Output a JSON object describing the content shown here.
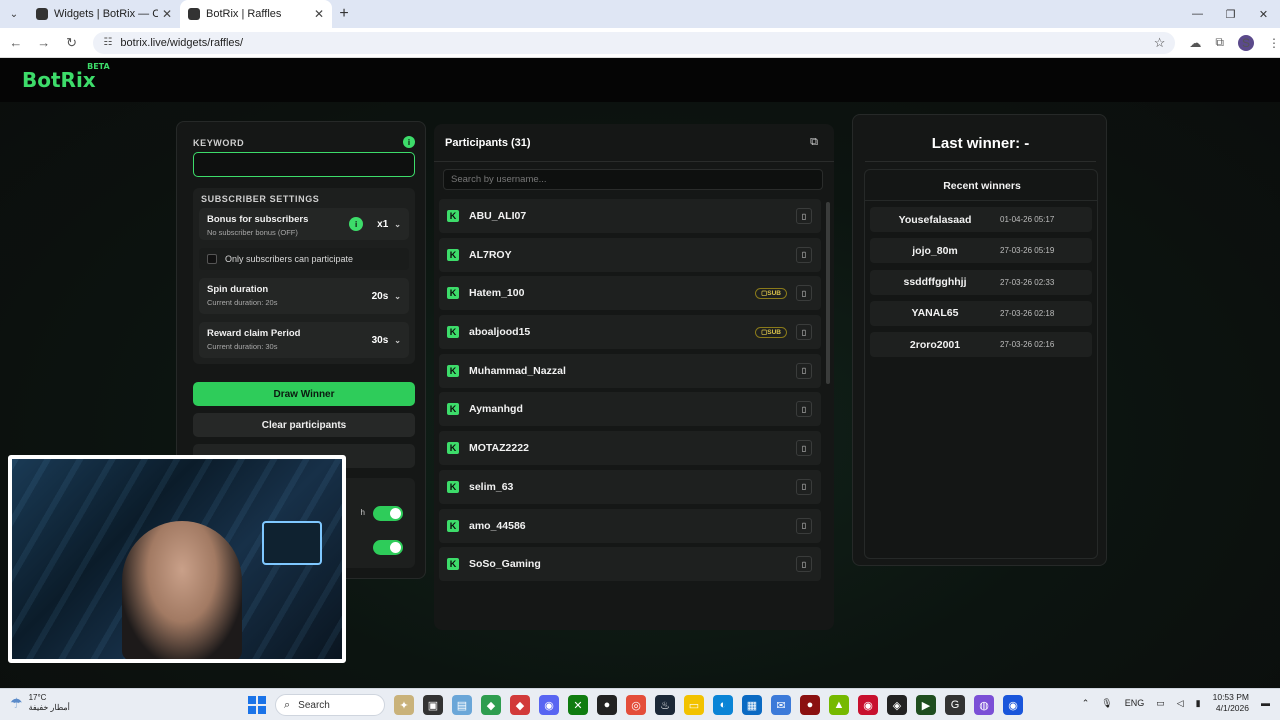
{
  "browser": {
    "tabs": [
      {
        "title": "Widgets | BotRix — Cloud Strea",
        "active": false
      },
      {
        "title": "BotRix | Raffles",
        "active": true
      }
    ],
    "url": "botrix.live/widgets/raffles/",
    "profile_initial": "S"
  },
  "app": {
    "logo": "BotRix",
    "logo_badge": "BETA",
    "accent_color": "#3ddc6a"
  },
  "settings": {
    "keyword_label": "KEYWORD",
    "keyword_value": "",
    "subscriber_settings_label": "SUBSCRIBER SETTINGS",
    "bonus": {
      "name": "Bonus for subscribers",
      "sub": "No subscriber bonus (OFF)",
      "value": "x1"
    },
    "only_subs_label": "Only subscribers can participate",
    "only_subs_checked": false,
    "spin": {
      "name": "Spin duration",
      "sub": "Current duration: 20s",
      "value": "20s"
    },
    "reward": {
      "name": "Reward claim Period",
      "sub": "Current duration: 30s",
      "value": "30s"
    },
    "draw_label": "Draw Winner",
    "clear_label": "Clear participants",
    "toggle_partial_label": "h",
    "toggles": [
      true,
      true
    ]
  },
  "participants": {
    "title": "Participants (31)",
    "search_placeholder": "Search by username...",
    "rows": [
      {
        "name": "ABU_ALI07",
        "badge": ""
      },
      {
        "name": "AL7ROY",
        "badge": ""
      },
      {
        "name": "Hatem_100",
        "badge": "SUB"
      },
      {
        "name": "aboaljood15",
        "badge": "SUB"
      },
      {
        "name": "Muhammad_Nazzal",
        "badge": ""
      },
      {
        "name": "Aymanhgd",
        "badge": ""
      },
      {
        "name": "MOTAZ2222",
        "badge": ""
      },
      {
        "name": "selim_63",
        "badge": ""
      },
      {
        "name": "amo_44586",
        "badge": ""
      },
      {
        "name": "SoSo_Gaming",
        "badge": ""
      }
    ]
  },
  "winner": {
    "last_winner": "Last winner: -",
    "recent_title": "Recent winners",
    "recent": [
      {
        "name": "Yousefalasaad",
        "date": "01-04-26 05:17"
      },
      {
        "name": "jojo_80m",
        "date": "27-03-26 05:19"
      },
      {
        "name": "ssddffgghhjj",
        "date": "27-03-26 02:33"
      },
      {
        "name": "YANAL65",
        "date": "27-03-26 02:18"
      },
      {
        "name": "2roro2001",
        "date": "27-03-26 02:16"
      }
    ]
  },
  "taskbar": {
    "temp": "17°C",
    "weather_text": "أمطار خفيفة",
    "search_label": "Search",
    "lang": "ENG",
    "time": "10:53 PM",
    "date": "4/1/2026"
  }
}
